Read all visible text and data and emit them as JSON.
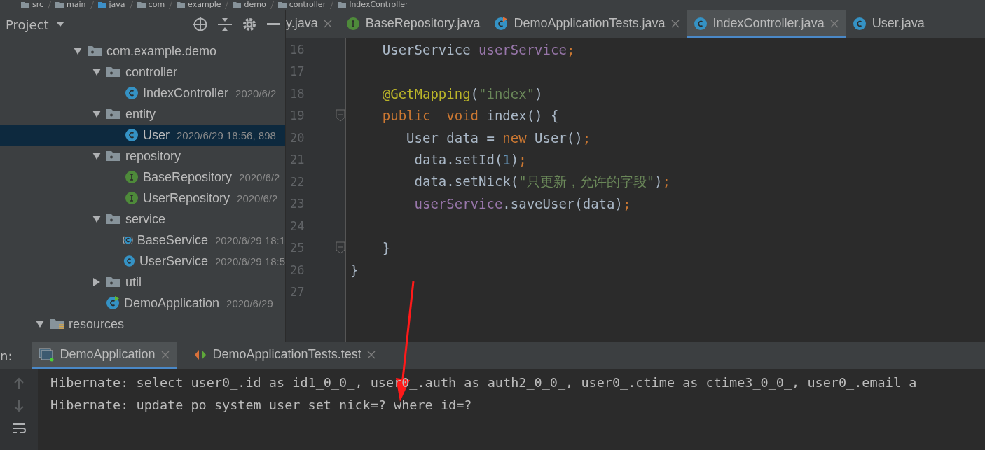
{
  "breadcrumb": [
    "src",
    "main",
    "java",
    "com",
    "example",
    "demo",
    "controller",
    "IndexController"
  ],
  "project_panel": {
    "title": "Project",
    "tree": [
      {
        "label": "com.example.demo",
        "kind": "package",
        "expanded": true,
        "selected": false,
        "children": [
          {
            "label": "controller",
            "kind": "package",
            "expanded": true,
            "selected": false,
            "children": [
              {
                "label": "IndexController",
                "kind": "class",
                "meta": "2020/6/2",
                "selected": false
              }
            ]
          },
          {
            "label": "entity",
            "kind": "package",
            "expanded": true,
            "selected": false,
            "children": [
              {
                "label": "User",
                "kind": "class",
                "meta": "2020/6/29 18:56, 898",
                "selected": true
              }
            ]
          },
          {
            "label": "repository",
            "kind": "package",
            "expanded": true,
            "selected": false,
            "children": [
              {
                "label": "BaseRepository",
                "kind": "interface",
                "meta": "2020/6/2",
                "selected": false
              },
              {
                "label": "UserRepository",
                "kind": "interface",
                "meta": "2020/6/2",
                "selected": false
              }
            ]
          },
          {
            "label": "service",
            "kind": "package",
            "expanded": true,
            "selected": false,
            "children": [
              {
                "label": "BaseService",
                "kind": "abstract",
                "meta": "2020/6/29 18:1",
                "selected": false
              },
              {
                "label": "UserService",
                "kind": "class",
                "meta": "2020/6/29 18:5",
                "selected": false
              }
            ]
          },
          {
            "label": "util",
            "kind": "package",
            "expanded": false,
            "selected": false
          },
          {
            "label": "DemoApplication",
            "kind": "app",
            "meta": "2020/6/29",
            "selected": false
          }
        ]
      },
      {
        "label": "resources",
        "kind": "resources",
        "expanded": true,
        "selected": false
      }
    ]
  },
  "editor": {
    "tabs": [
      {
        "label": "y.java",
        "kind": "none",
        "selected": false,
        "closable": true
      },
      {
        "label": "BaseRepository.java",
        "kind": "interface",
        "selected": false,
        "closable": false
      },
      {
        "label": "DemoApplicationTests.java",
        "kind": "test",
        "selected": false,
        "closable": true
      },
      {
        "label": "IndexController.java",
        "kind": "class",
        "selected": true,
        "closable": true
      },
      {
        "label": "User.java",
        "kind": "class",
        "selected": false,
        "closable": false
      }
    ],
    "lines": [
      {
        "number": "16",
        "fold": false,
        "tokens": [
          {
            "kind": "plain",
            "text": "    UserService "
          },
          {
            "kind": "field",
            "text": "userService"
          },
          {
            "kind": "keyword",
            "text": ";"
          }
        ]
      },
      {
        "number": "17",
        "fold": false
      },
      {
        "number": "18",
        "fold": false,
        "tokens": [
          {
            "kind": "annotation",
            "text": "    @GetMapping"
          },
          {
            "kind": "plain",
            "text": "("
          },
          {
            "kind": "string",
            "text": "\"index\""
          },
          {
            "kind": "plain",
            "text": ")"
          }
        ]
      },
      {
        "number": "19",
        "fold": true,
        "tokens": [
          {
            "kind": "keyword",
            "text": "    public  void "
          },
          {
            "kind": "plain",
            "text": "index() {"
          }
        ]
      },
      {
        "number": "20",
        "fold": false,
        "tokens": [
          {
            "kind": "plain",
            "text": "       User data = "
          },
          {
            "kind": "keyword",
            "text": "new "
          },
          {
            "kind": "plain",
            "text": "User()"
          },
          {
            "kind": "keyword",
            "text": ";"
          }
        ]
      },
      {
        "number": "21",
        "fold": false,
        "tokens": [
          {
            "kind": "plain",
            "text": "        data.setId("
          },
          {
            "kind": "number",
            "text": "1"
          },
          {
            "kind": "plain",
            "text": ")"
          },
          {
            "kind": "keyword",
            "text": ";"
          }
        ]
      },
      {
        "number": "22",
        "fold": false,
        "tokens": [
          {
            "kind": "plain",
            "text": "        data.setNick("
          },
          {
            "kind": "string",
            "text": "\"只更新，允许的字段\""
          },
          {
            "kind": "plain",
            "text": ")"
          },
          {
            "kind": "keyword",
            "text": ";"
          }
        ]
      },
      {
        "number": "23",
        "fold": false,
        "tokens": [
          {
            "kind": "field",
            "text": "        userService"
          },
          {
            "kind": "plain",
            "text": ".saveUser(data)"
          },
          {
            "kind": "keyword",
            "text": ";"
          }
        ]
      },
      {
        "number": "24",
        "fold": false
      },
      {
        "number": "25",
        "fold": true,
        "tokens": [
          {
            "kind": "plain",
            "text": "    }"
          }
        ]
      },
      {
        "number": "26",
        "fold": false,
        "tokens": [
          {
            "kind": "plain",
            "text": "}"
          }
        ]
      },
      {
        "number": "27",
        "fold": false
      }
    ]
  },
  "run_panel": {
    "label": "n:",
    "tabs": [
      {
        "label": "DemoApplication",
        "kind": "app",
        "selected": true
      },
      {
        "label": "DemoApplicationTests.test",
        "kind": "test",
        "selected": false
      }
    ],
    "console": [
      "Hibernate: select user0_.id as id1_0_0_, user0_.auth as auth2_0_0_, user0_.ctime as ctime3_0_0_, user0_.email a",
      "Hibernate: update po_system_user set nick=? where id=?"
    ]
  }
}
